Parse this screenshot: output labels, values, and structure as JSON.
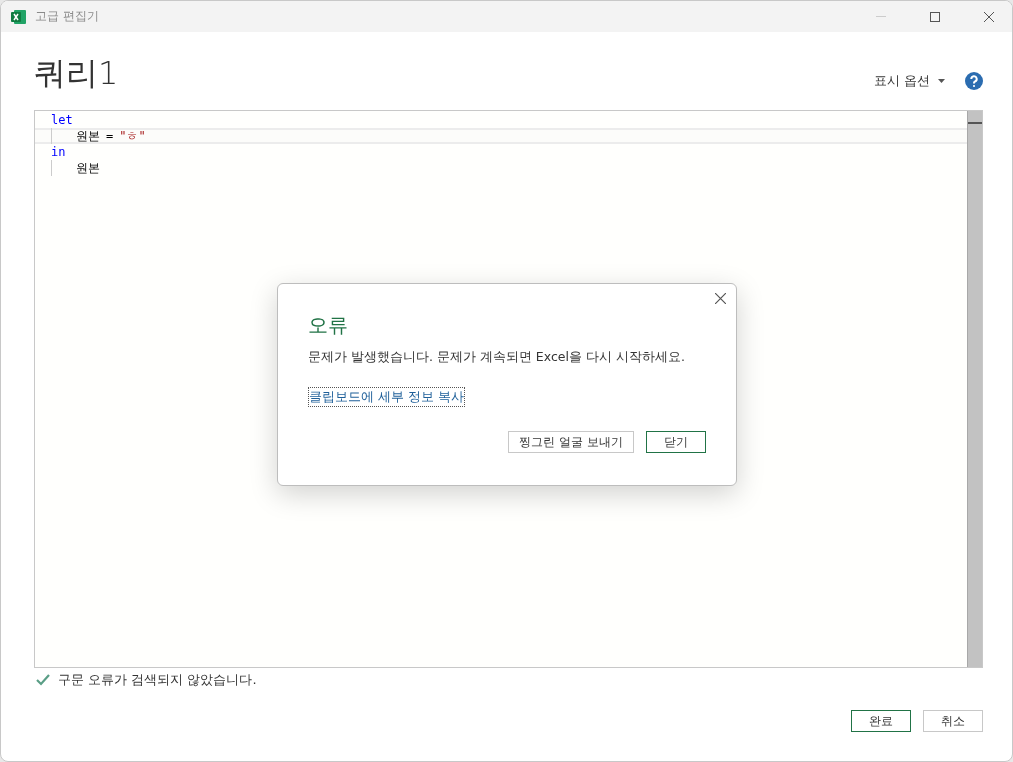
{
  "window": {
    "title": "고급 편집기"
  },
  "heading": "쿼리1",
  "display_options": "표시 옵션",
  "code": {
    "lines": [
      {
        "indent": false,
        "current": false,
        "tokens": [
          {
            "kind": "keyword",
            "text": "let"
          }
        ]
      },
      {
        "indent": true,
        "current": true,
        "tokens": [
          {
            "kind": "ident",
            "text": "원본"
          },
          {
            "kind": "op",
            "text": "="
          },
          {
            "kind": "string",
            "text": "\"ㅎ\""
          }
        ]
      },
      {
        "indent": false,
        "current": false,
        "tokens": [
          {
            "kind": "keyword",
            "text": "in"
          }
        ]
      },
      {
        "indent": true,
        "current": false,
        "tokens": [
          {
            "kind": "ident",
            "text": "원본"
          }
        ]
      }
    ]
  },
  "status": "구문 오류가 검색되지 않았습니다.",
  "buttons": [
    {
      "label": "완료",
      "primary": true
    },
    {
      "label": "취소",
      "primary": false
    }
  ],
  "dialog": {
    "title": "오류",
    "message": "문제가 발생했습니다. 문제가 계속되면 Excel을 다시 시작하세요.",
    "link": "클립보드에 세부 정보 복사",
    "buttons": [
      {
        "label": "찡그린 얼굴 보내기",
        "primary": false
      },
      {
        "label": "닫기",
        "primary": true
      }
    ]
  }
}
